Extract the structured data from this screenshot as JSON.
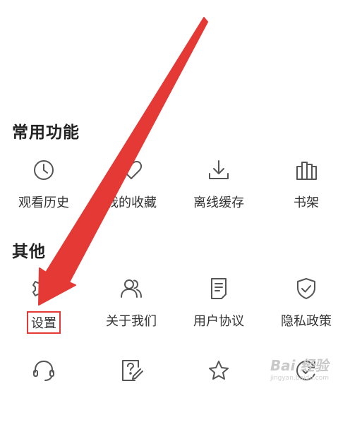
{
  "sections": {
    "common": {
      "title": "常用功能",
      "items": [
        {
          "label": "观看历史",
          "icon": "clock-icon"
        },
        {
          "label": "我的收藏",
          "icon": "heart-icon"
        },
        {
          "label": "离线缓存",
          "icon": "download-icon"
        },
        {
          "label": "书架",
          "icon": "bookshelf-icon"
        }
      ]
    },
    "other": {
      "title": "其他",
      "items": [
        {
          "label": "设置",
          "icon": "gear-icon"
        },
        {
          "label": "关于我们",
          "icon": "users-icon"
        },
        {
          "label": "用户协议",
          "icon": "document-icon"
        },
        {
          "label": "隐私政策",
          "icon": "shield-icon"
        }
      ],
      "row3_icons": [
        "headset-icon",
        "feedback-icon",
        "star-icon",
        "refresh-icon"
      ]
    }
  },
  "watermark": {
    "text": "Bai 经验",
    "sub": "jingyan.baidu.com"
  },
  "colors": {
    "annotation": "#e53935",
    "icon": "#555555",
    "text": "#333333"
  }
}
